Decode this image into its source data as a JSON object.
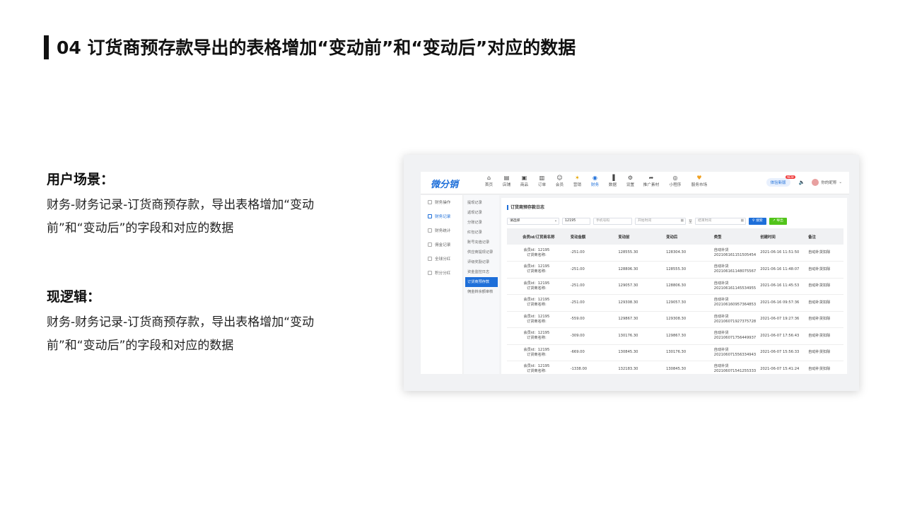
{
  "title": "04 订货商预存款导出的表格增加“变动前”和“变动后”对应的数据",
  "sections": [
    {
      "heading": "用户场景：",
      "body": "财务-财务记录-订货商预存款，导出表格增加“变动前”和“变动后”的字段和对应的数据"
    },
    {
      "heading": "现逻辑：",
      "body": "财务-财务记录-订货商预存款，导出表格增加“变动前”和“变动后”的字段和对应的数据"
    }
  ],
  "app": {
    "logo": "微分销",
    "nav": [
      {
        "label": "首页",
        "icon": "home-icon"
      },
      {
        "label": "店铺",
        "icon": "shop-icon"
      },
      {
        "label": "商品",
        "icon": "goods-icon"
      },
      {
        "label": "订单",
        "icon": "order-icon"
      },
      {
        "label": "会员",
        "icon": "member-icon"
      },
      {
        "label": "营销",
        "icon": "marketing-icon"
      },
      {
        "label": "财务",
        "icon": "finance-icon"
      },
      {
        "label": "数据",
        "icon": "data-icon"
      },
      {
        "label": "设置",
        "icon": "settings-icon"
      },
      {
        "label": "推广素材",
        "icon": "share-icon"
      },
      {
        "label": "小程序",
        "icon": "miniapp-icon"
      },
      {
        "label": "服务市场",
        "icon": "market-icon"
      }
    ],
    "right": {
      "pill": "体验新版",
      "badge": "NEW",
      "user": "你的昵称"
    },
    "left_menu": [
      "财务操作",
      "财务记录",
      "财务统计",
      "佣金记录",
      "全球分红",
      "积分分红"
    ],
    "sub_menu": [
      "提现记录",
      "返现记录",
      "分账记录",
      "红包记录",
      "账号充值记录",
      "供应商提现记录",
      "评级奖励记录",
      "资金监控日志",
      "订货商预存款",
      "佣金转余额审核"
    ],
    "content_title": "订货商预存款日志",
    "filters": {
      "select": "请选择",
      "member_id": "12195",
      "phone_placeholder": "手机号码",
      "start_placeholder": "开始时间",
      "sep": "至",
      "end_placeholder": "结束时间",
      "search": "搜索",
      "export": "导出"
    },
    "table": {
      "headers": [
        "会员id/订货商名称",
        "变动金额",
        "变动前",
        "变动后",
        "类型",
        "创建时间",
        "备注"
      ],
      "rows": [
        {
          "member": "会员id：12195",
          "name": "订货商名称:",
          "amount": "-251.00",
          "before": "128555.30",
          "after": "128304.30",
          "type": "自动补货",
          "type_no": "202106161151505454",
          "time": "2021-06-16 11:51:50",
          "note": "自动补货扣除"
        },
        {
          "member": "会员id：12195",
          "name": "订货商名称:",
          "amount": "-251.00",
          "before": "128806.30",
          "after": "128555.30",
          "type": "自动补货",
          "type_no": "202106161148075567",
          "time": "2021-06-16 11:48:07",
          "note": "自动补货扣除"
        },
        {
          "member": "会员id：12195",
          "name": "订货商名称:",
          "amount": "-251.00",
          "before": "129057.30",
          "after": "128806.30",
          "type": "自动补货",
          "type_no": "202106161145534955",
          "time": "2021-06-16 11:45:53",
          "note": "自动补货扣除"
        },
        {
          "member": "会员id：12195",
          "name": "订货商名称:",
          "amount": "-251.00",
          "before": "129308.30",
          "after": "129057.30",
          "type": "自动补货",
          "type_no": "202106160957364853",
          "time": "2021-06-16 09:57:36",
          "note": "自动补货扣除"
        },
        {
          "member": "会员id：12195",
          "name": "订货商名称:",
          "amount": "-559.00",
          "before": "129867.30",
          "after": "129308.30",
          "type": "自动补货",
          "type_no": "202106071927375728",
          "time": "2021-06-07 19:27:36",
          "note": "自动补货扣除"
        },
        {
          "member": "会员id：12195",
          "name": "订货商名称:",
          "amount": "-309.00",
          "before": "130176.30",
          "after": "129867.30",
          "type": "自动补货",
          "type_no": "202106071756449937",
          "time": "2021-06-07 17:56:43",
          "note": "自动补货扣除"
        },
        {
          "member": "会员id：12195",
          "name": "订货商名称:",
          "amount": "-669.00",
          "before": "130845.30",
          "after": "130176.30",
          "type": "自动补货",
          "type_no": "202106071556334943",
          "time": "2021-06-07 15:56:33",
          "note": "自动补货扣除"
        },
        {
          "member": "会员id：12195",
          "name": "订货商名称:",
          "amount": "-1338.00",
          "before": "132183.30",
          "after": "130845.30",
          "type": "自动补货",
          "type_no": "202106071541255333",
          "time": "2021-06-07 15:41:24",
          "note": "自动补货扣除"
        }
      ]
    }
  }
}
